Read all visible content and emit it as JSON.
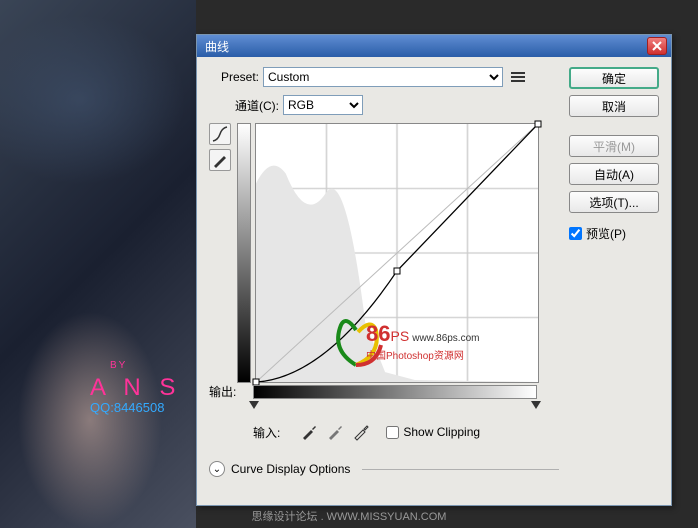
{
  "dialog": {
    "title": "曲线",
    "preset_label": "Preset:",
    "preset_value": "Custom",
    "channel_label": "通道(C):",
    "channel_value": "RGB",
    "output_label": "输出:",
    "input_label": "输入:",
    "show_clipping_label": "Show Clipping",
    "display_options_label": "Curve Display Options"
  },
  "buttons": {
    "ok": "确定",
    "cancel": "取消",
    "smooth": "平滑(M)",
    "auto": "自动(A)",
    "options": "选项(T)...",
    "preview": "预览(P)"
  },
  "watermark": {
    "by": "BY",
    "ans": "A N S",
    "qq": "QQ:8446508",
    "logo_num": "86",
    "logo_ps": "PS",
    "logo_url": "www.86ps.com",
    "logo_cn": "中国Photoshop资源网",
    "footer": "思缘设计论坛 . WWW.MISSYUAN.COM"
  },
  "chart_data": {
    "type": "line",
    "title": "",
    "xlabel": "输入",
    "ylabel": "输出",
    "xlim": [
      0,
      255
    ],
    "ylim": [
      0,
      255
    ],
    "series": [
      {
        "name": "RGB curve",
        "x": [
          0,
          50,
          128,
          255
        ],
        "y": [
          0,
          15,
          110,
          255
        ]
      }
    ],
    "annotations": [
      "baseline diagonal 0,0→255,255"
    ],
    "grid": true
  },
  "state": {
    "preview_checked": true,
    "show_clipping_checked": false
  }
}
